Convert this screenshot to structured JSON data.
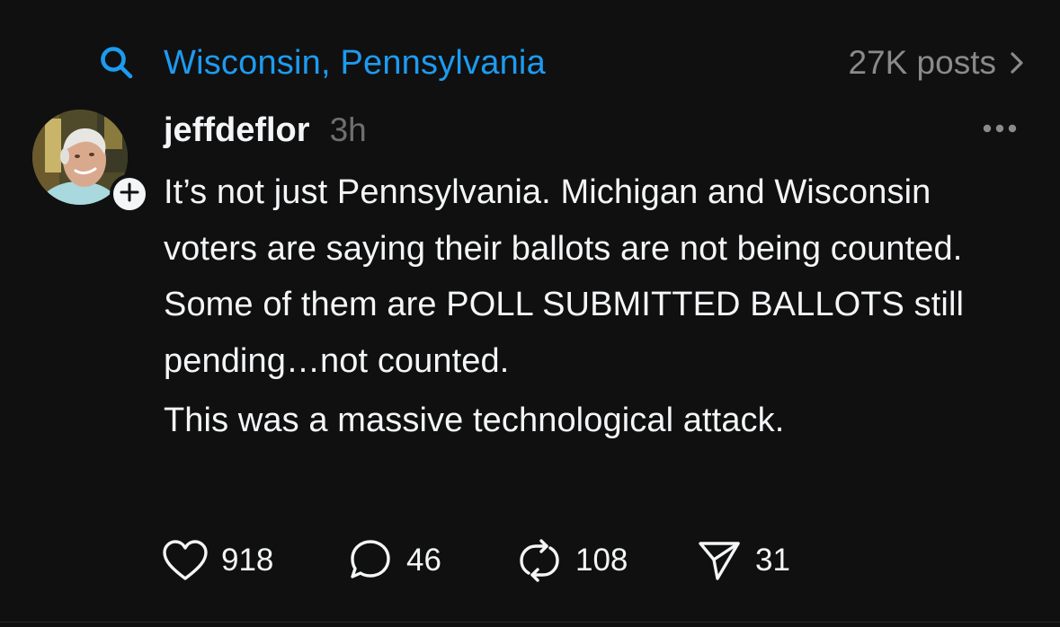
{
  "topic": {
    "label": "Wisconsin, Pennsylvania",
    "count": "27K posts",
    "icon": "search-icon",
    "accent_color": "#1d9bf0"
  },
  "post": {
    "author": {
      "username": "jeffdeflor",
      "avatar": "avatar",
      "follow_icon": "plus-icon"
    },
    "time": "3h",
    "more_icon": "more-horizontal-icon",
    "body": {
      "paragraph_1": "It’s not just Pennsylvania. Michigan and Wisconsin voters are saying their ballots are not being counted. Some of them are POLL SUBMITTED BALLOTS still pending…not counted.",
      "paragraph_2": "This was a massive technological attack."
    },
    "actions": {
      "likes": {
        "icon": "heart-icon",
        "count": "918"
      },
      "replies": {
        "icon": "comment-icon",
        "count": "46"
      },
      "reposts": {
        "icon": "repost-icon",
        "count": "108"
      },
      "shares": {
        "icon": "send-icon",
        "count": "31"
      }
    }
  }
}
